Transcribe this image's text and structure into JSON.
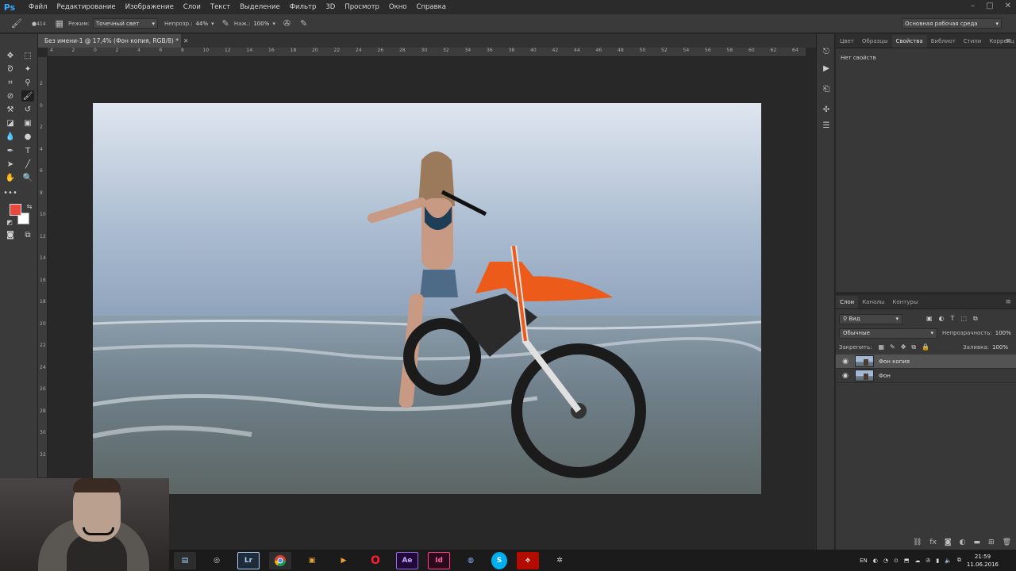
{
  "app": {
    "logo": "Ps"
  },
  "menu": [
    "Файл",
    "Редактирование",
    "Изображение",
    "Слои",
    "Текст",
    "Выделение",
    "Фильтр",
    "3D",
    "Просмотр",
    "Окно",
    "Справка"
  ],
  "options": {
    "brush_size": "414",
    "mode_label": "Режим:",
    "mode_value": "Точечный свет",
    "opacity_label": "Непрозр.:",
    "opacity_value": "44%",
    "pressure_label": "Наж.:",
    "pressure_value": "100%",
    "workspace": "Основная рабочая среда"
  },
  "document": {
    "tab_title": "Без имени-1 @ 17,4% (Фон копия, RGB/8) *",
    "ruler_top": [
      "4",
      "2",
      "0",
      "2",
      "4",
      "6",
      "8",
      "10",
      "12",
      "14",
      "16",
      "18",
      "20",
      "22",
      "24",
      "26",
      "28",
      "30",
      "32",
      "34",
      "36",
      "38",
      "40",
      "42",
      "44",
      "46",
      "48",
      "50",
      "52",
      "54",
      "56",
      "58",
      "60",
      "62",
      "64"
    ],
    "ruler_left": [
      "2",
      "0",
      "2",
      "4",
      "6",
      "8",
      "10",
      "12",
      "14",
      "16",
      "18",
      "20",
      "22",
      "24",
      "26",
      "28",
      "30",
      "32"
    ]
  },
  "colors": {
    "foreground": "#e8483e",
    "background": "#ffffff",
    "accent": "#31a8ff"
  },
  "properties_panel": {
    "tabs": [
      "Цвет",
      "Образцы",
      "Свойства",
      "Библиот",
      "Стили",
      "Коррекц"
    ],
    "active_tab": "Свойства",
    "empty_text": "Нет свойств"
  },
  "layers_panel": {
    "tabs": [
      "Слои",
      "Каналы",
      "Контуры"
    ],
    "filter_label": "Вид",
    "blend_mode": "Обычные",
    "opacity_label": "Непрозрачность:",
    "opacity_value": "100%",
    "lock_label": "Закрепить:",
    "fill_label": "Заливка:",
    "fill_value": "100%",
    "layers": [
      {
        "name": "Фон копия",
        "visible": true,
        "selected": true
      },
      {
        "name": "Фон",
        "visible": true,
        "selected": false
      }
    ]
  },
  "taskbar": {
    "apps": [
      "explorer",
      "media",
      "Lr",
      "chrome",
      "app",
      "player",
      "opera",
      "Ae",
      "Id",
      "app2",
      "skype",
      "acrobat",
      "app3"
    ],
    "language": "EN",
    "time": "21:59",
    "date": "11.06.2016"
  }
}
